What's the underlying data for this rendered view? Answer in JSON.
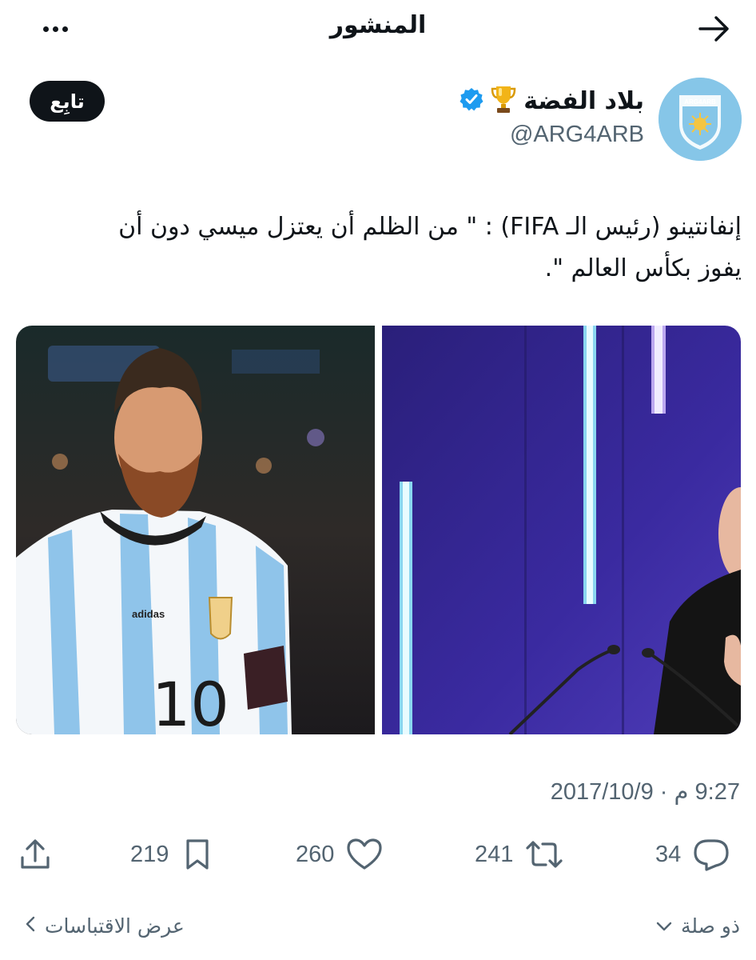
{
  "header": {
    "title": "المنشور"
  },
  "author": {
    "display_name": "بلاد الفضة",
    "handle": "@ARG4ARB",
    "avatar_text": "ARG4ARB",
    "follow_label": "تابِع",
    "verified": true
  },
  "tweet": {
    "text_line_1": "إنفانتينو (رئيس الـ FIFA) : \" من الظلم أن يعتزل ميسي دون أن",
    "text_line_2": "يفوز بكأس العالم \".",
    "timestamp": "9:27 م · 2017/10/9",
    "media": [
      {
        "description": "",
        "number": "10"
      },
      {
        "description": ""
      }
    ]
  },
  "actions": {
    "replies": "34",
    "reposts": "241",
    "likes": "260",
    "bookmarks": "219"
  },
  "footer": {
    "relevant_label": "ذو صلة",
    "quotes_label": "عرض الاقتباسات"
  },
  "colors": {
    "text": "#0f1419",
    "secondary": "#536471",
    "verified": "#1d9bf0",
    "avatar_bg": "#86c6e8"
  }
}
